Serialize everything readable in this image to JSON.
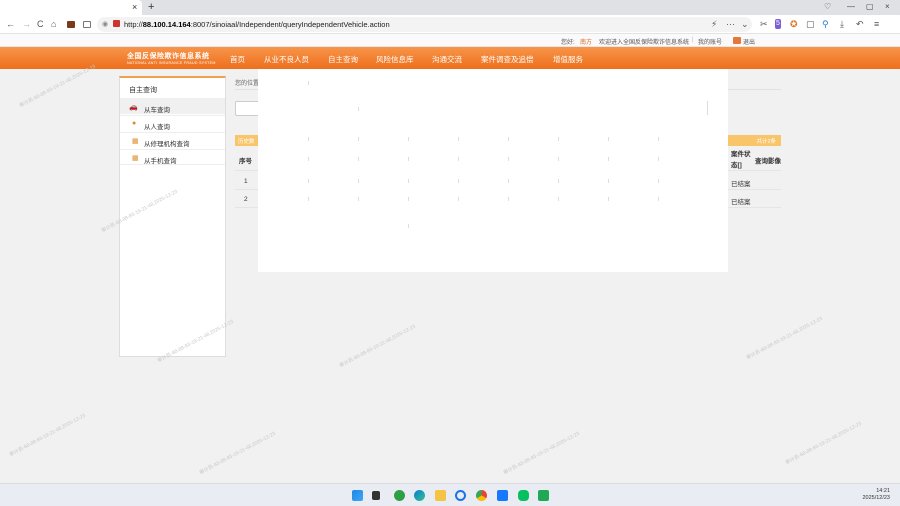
{
  "browser": {
    "tab_close": "×",
    "new_tab": "+",
    "window_controls": [
      "♡",
      "—",
      "▢",
      "×"
    ],
    "nav_buttons": [
      "←",
      "→",
      "C",
      "⌂"
    ],
    "address_prefix": "http://",
    "address_host": "88.100.14.164",
    "address_path": ":8007/sinoiaal/Independent/queryIndependentVehicle.action",
    "right_icons": [
      "⚡",
      "···",
      "⌄",
      "✂",
      "5",
      "✪",
      "▢",
      "⚲",
      "⤓",
      "↶",
      "≡"
    ]
  },
  "sitebar": {
    "greeting": "您好:",
    "user": "南方",
    "welcome": "欢迎进入全国反保险欺诈信息系统",
    "account": "我的账号",
    "logout": "退出"
  },
  "nav": {
    "logo_cn": "全国反保险欺诈信息系统",
    "logo_en": "NATIONAL ANTI INSURANCE FRAUD SYSTEM",
    "items": [
      "首页",
      "从业不良人员",
      "自主查询",
      "风险信息库",
      "沟通交流",
      "案件调查及追偿",
      "增值服务"
    ]
  },
  "sidebar": {
    "title": "自主查询",
    "items": [
      "从车查询",
      "从人查询",
      "从修理机构查询",
      "从手机查询"
    ]
  },
  "main": {
    "breadcrumb": "您的位置",
    "table_bar_left": "历史数",
    "table_bar_right": "共计2条",
    "headers": [
      "序号",
      "案件状态[]",
      "查询影像"
    ],
    "rows": [
      {
        "index": "1",
        "status": "已结案"
      },
      {
        "index": "2",
        "status": "已结案"
      }
    ]
  },
  "watermark": "审计员-88-88-83-19-21-48,2025-12-23",
  "taskbar": {
    "time": "14:21",
    "date": "2025/12/23"
  }
}
